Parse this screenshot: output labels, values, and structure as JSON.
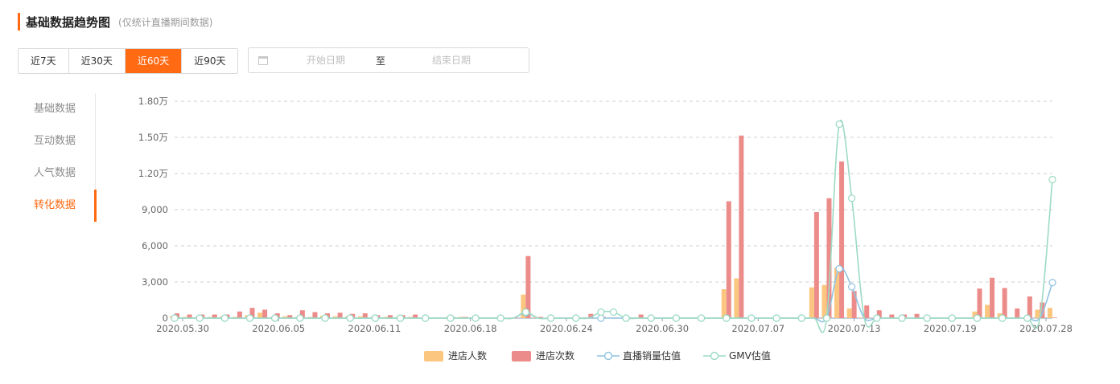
{
  "header": {
    "title": "基础数据趋势图",
    "subtitle": "(仅统计直播期间数据)"
  },
  "range_buttons": [
    {
      "label": "近7天",
      "active": false
    },
    {
      "label": "近30天",
      "active": false
    },
    {
      "label": "近60天",
      "active": true
    },
    {
      "label": "近90天",
      "active": false
    }
  ],
  "date_picker": {
    "start_placeholder": "开始日期",
    "separator": "至",
    "end_placeholder": "结束日期"
  },
  "nav": [
    {
      "label": "基础数据",
      "active": false
    },
    {
      "label": "互动数据",
      "active": false
    },
    {
      "label": "人气数据",
      "active": false
    },
    {
      "label": "转化数据",
      "active": true
    }
  ],
  "colors": {
    "accent": "#ff6a13",
    "visitors": "#fbc680",
    "visits": "#ec8c8a",
    "sales": "#8fc3e0",
    "gmv": "#9cdbc3"
  },
  "chart_data": {
    "type": "bar",
    "x_ticks": [
      "2020.05.30",
      "2020.06.05",
      "2020.06.11",
      "2020.06.18",
      "2020.06.24",
      "2020.06.30",
      "2020.07.07",
      "2020.07.13",
      "2020.07.19",
      "2020.07.28"
    ],
    "y_ticks": [
      "0",
      "3,000",
      "6,000",
      "9,000",
      "1.20万",
      "1.50万",
      "1.80万"
    ],
    "ylim": [
      0,
      18000
    ],
    "grid": true,
    "legend_position": "bottom",
    "series": [
      {
        "name": "进店人数",
        "kind": "bar",
        "values": [
          150,
          100,
          100,
          100,
          150,
          100,
          250,
          450,
          100,
          150,
          100,
          100,
          200,
          150,
          150,
          150,
          100,
          100,
          100,
          100,
          50,
          50,
          100,
          100,
          50,
          50,
          50,
          50,
          1950,
          100,
          50,
          50,
          50,
          50,
          50,
          50,
          50,
          50,
          50,
          50,
          50,
          50,
          50,
          50,
          2400,
          3300,
          50,
          50,
          50,
          50,
          50,
          2550,
          2750,
          4200,
          800,
          50,
          50,
          50,
          50,
          50,
          50,
          50,
          50,
          50,
          550,
          1100,
          400,
          50,
          50,
          700,
          850
        ]
      },
      {
        "name": "进店次数",
        "kind": "bar",
        "values": [
          400,
          300,
          300,
          300,
          300,
          550,
          850,
          700,
          400,
          250,
          650,
          500,
          400,
          450,
          350,
          400,
          250,
          250,
          250,
          300,
          50,
          50,
          100,
          100,
          50,
          50,
          50,
          50,
          5150,
          100,
          50,
          50,
          50,
          350,
          100,
          50,
          50,
          300,
          50,
          50,
          50,
          50,
          50,
          50,
          9700,
          15150,
          50,
          50,
          50,
          50,
          50,
          8800,
          9950,
          13000,
          2250,
          1050,
          650,
          300,
          300,
          350,
          50,
          50,
          50,
          50,
          2450,
          3350,
          2500,
          800,
          1800,
          1300,
          50
        ]
      },
      {
        "name": "直播销量估值",
        "kind": "line",
        "values": [
          0,
          0,
          0,
          0,
          0,
          0,
          0,
          0,
          0,
          0,
          0,
          0,
          0,
          0,
          0,
          0,
          0,
          0,
          0,
          0,
          0,
          0,
          0,
          0,
          0,
          0,
          0,
          0,
          450,
          0,
          0,
          0,
          0,
          0,
          0,
          0,
          0,
          0,
          0,
          0,
          0,
          0,
          0,
          0,
          0,
          0,
          0,
          0,
          0,
          0,
          0,
          0,
          0,
          4100,
          2600,
          0,
          0,
          0,
          0,
          0,
          0,
          0,
          0,
          0,
          0,
          0,
          0,
          0,
          0,
          0,
          2950
        ]
      },
      {
        "name": "GMV估值",
        "kind": "line",
        "values": [
          0,
          0,
          0,
          0,
          0,
          0,
          0,
          0,
          0,
          0,
          0,
          0,
          0,
          0,
          0,
          0,
          0,
          0,
          0,
          0,
          0,
          0,
          0,
          0,
          0,
          0,
          0,
          0,
          500,
          0,
          0,
          0,
          0,
          0,
          500,
          500,
          0,
          0,
          0,
          0,
          0,
          0,
          0,
          0,
          0,
          0,
          0,
          0,
          0,
          0,
          0,
          0,
          0,
          16100,
          9950,
          0,
          0,
          0,
          0,
          0,
          0,
          0,
          0,
          0,
          0,
          0,
          0,
          0,
          0,
          0,
          11500
        ]
      }
    ]
  }
}
